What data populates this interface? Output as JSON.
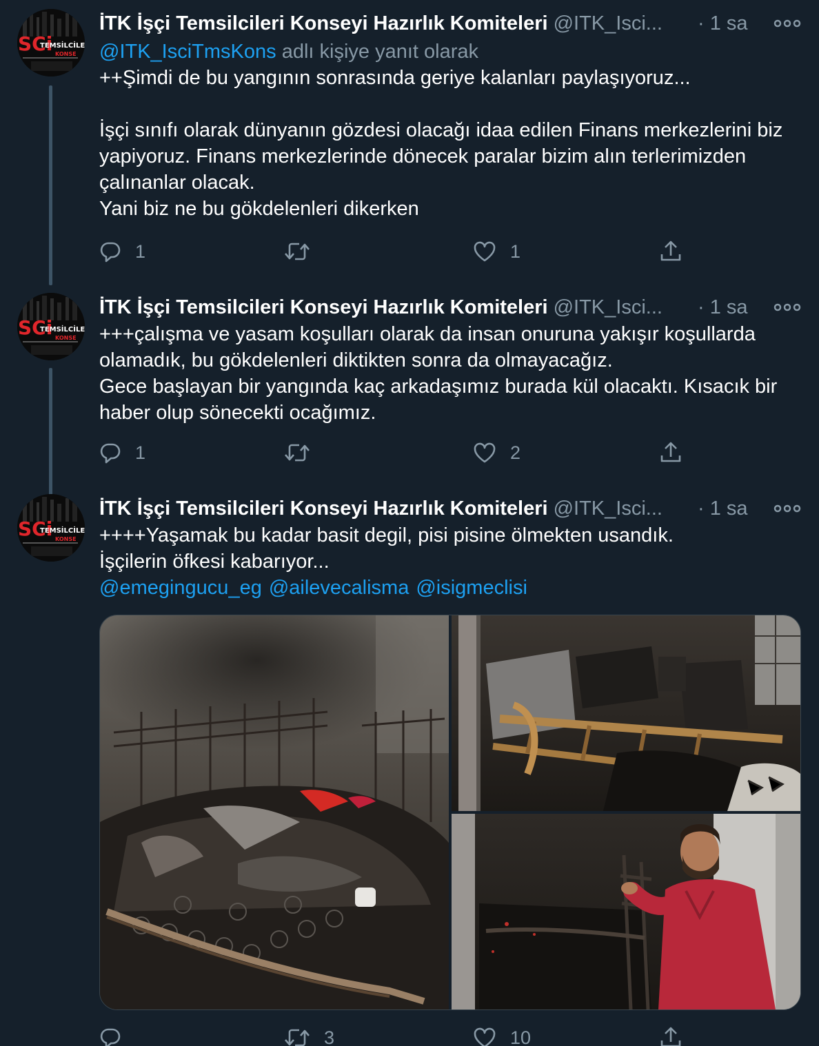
{
  "tweets": [
    {
      "author_name": "İTK İşçi Temsilcileri Konseyi Hazırlık Komiteleri",
      "author_handle": "@ITK_Isci...",
      "dot": "·",
      "time": "1 sa",
      "reply_prefix": "@ITK_IsciTmsKons",
      "reply_suffix": " adlı kişiye yanıt olarak",
      "text": "++Şimdi de bu yangının sonrasında geriye kalanları paylaşıyoruz...\n\nİşçi sınıfı olarak dünyanın gözdesi olacağı idaa  edilen Finans merkezlerini biz yapiyoruz. Finans merkezlerinde dönecek paralar bizim alın terlerimizden çalınanlar olacak.\nYani biz ne bu gökdelenleri dikerken",
      "reply_count": "1",
      "retweet_count": "",
      "like_count": "1"
    },
    {
      "author_name": "İTK İşçi Temsilcileri Konseyi Hazırlık Komiteleri",
      "author_handle": "@ITK_Isci...",
      "dot": "·",
      "time": "1 sa",
      "text": "+++çalışma ve yasam koşulları olarak da insan onuruna yakışır koşullarda olamadık, bu gökdelenleri diktikten sonra da olmayacağız.\nGece başlayan bir yangında kaç arkadaşımız burada kül olacaktı. Kısacık bir haber olup sönecekti ocağımız.",
      "reply_count": "1",
      "retweet_count": "",
      "like_count": "2"
    },
    {
      "author_name": "İTK İşçi Temsilcileri Konseyi Hazırlık Komiteleri",
      "author_handle": "@ITK_Isci...",
      "dot": "·",
      "time": "1 sa",
      "text": "++++Yaşamak bu kadar basit degil, pisi pisine ölmekten usandık.\n İşçilerin öfkesi kabarıyor...",
      "mentions": [
        "@emegingucu_eg",
        "@ailevecalisma",
        "@isigmeclisi"
      ],
      "reply_count": "",
      "retweet_count": "3",
      "like_count": "10"
    }
  ],
  "avatar_text": {
    "big": "SCi",
    "small": "TEMSİLCİLEF",
    "sub": "KONSE"
  },
  "icons": {
    "reply": "reply-icon",
    "retweet": "retweet-icon",
    "like": "heart-icon",
    "share": "share-icon",
    "more": "more-icon"
  },
  "colors": {
    "background": "#15202b",
    "text": "#ffffff",
    "secondary": "#8899a6",
    "link": "#1da1f2",
    "thread_line": "#3d5466",
    "avatar_red": "#e0262b"
  }
}
